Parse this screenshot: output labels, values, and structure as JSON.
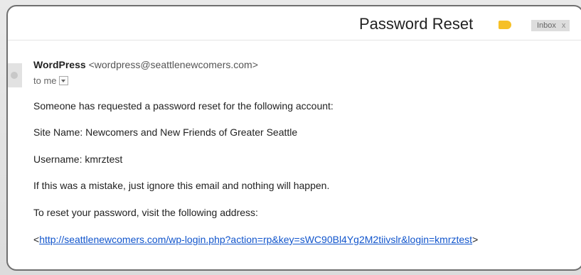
{
  "email": {
    "subject": "Password Reset",
    "label": {
      "name": "Inbox",
      "close": "x",
      "tag_color": "#f6c026"
    },
    "sender": {
      "name": "WordPress",
      "email": "<wordpress@seattlenewcomers.com>"
    },
    "recipient": "to me",
    "body": {
      "line1": "Someone has requested a password reset for the following account:",
      "line2": "Site Name: Newcomers and New Friends of Greater Seattle",
      "line3": "Username: kmrztest",
      "line4": "If this was a mistake, just ignore this email and nothing will happen.",
      "line5": "To reset your password, visit the following address:",
      "link_open": "<",
      "link": "http://seattlenewcomers.com/wp-login.php?action=rp&key=sWC90Bl4Yg2M2tiivslr&login=kmrztest",
      "link_close": ">"
    }
  },
  "colors": {
    "link": "#1155cc",
    "label_badge": "#dddddd"
  }
}
